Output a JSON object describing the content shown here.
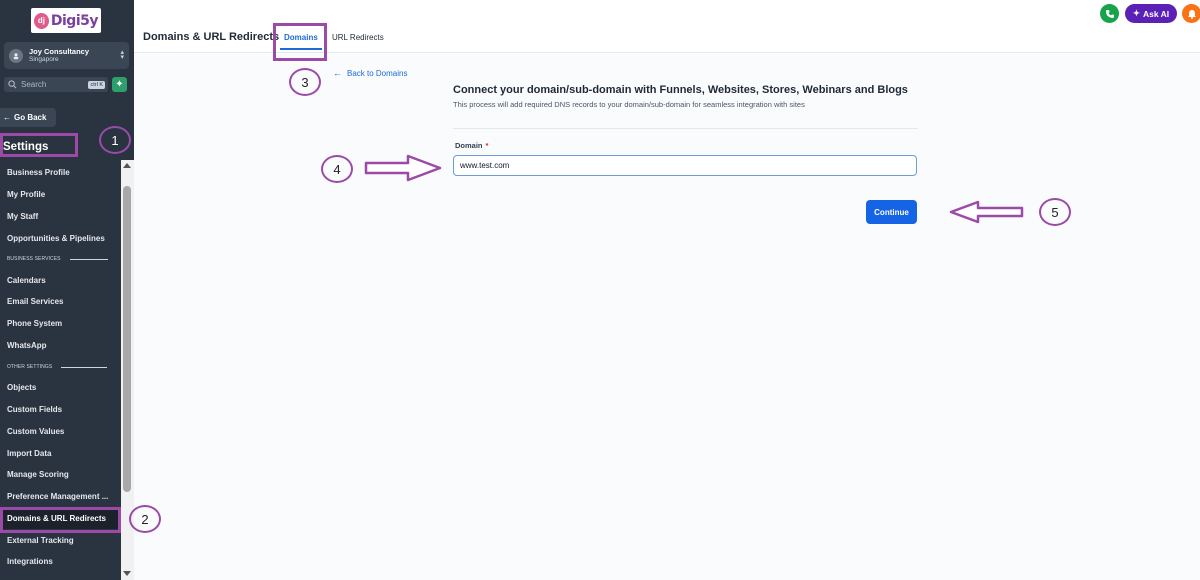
{
  "logo": {
    "text": "Digi5y",
    "mark": "dj",
    "tagline": "ALL IN ONE BUSINESS PLATFORM"
  },
  "account": {
    "name": "Joy Consultancy",
    "location": "Singapore"
  },
  "search": {
    "placeholder": "Search",
    "shortcut": "ctrl K"
  },
  "sidebar": {
    "go_back": "Go Back",
    "title": "Settings",
    "items": [
      {
        "label": "Business Profile"
      },
      {
        "label": "My Profile"
      },
      {
        "label": "My Staff"
      },
      {
        "label": "Opportunities & Pipelines"
      },
      {
        "section": "BUSINESS SERVICES"
      },
      {
        "label": "Calendars"
      },
      {
        "label": "Email Services"
      },
      {
        "label": "Phone System"
      },
      {
        "label": "WhatsApp"
      },
      {
        "section": "OTHER SETTINGS"
      },
      {
        "label": "Objects"
      },
      {
        "label": "Custom Fields"
      },
      {
        "label": "Custom Values"
      },
      {
        "label": "Import Data"
      },
      {
        "label": "Manage Scoring"
      },
      {
        "label": "Preference Management ..."
      },
      {
        "label": "Domains & URL Redirects",
        "active": true
      },
      {
        "label": "External Tracking"
      },
      {
        "label": "Integrations"
      }
    ]
  },
  "header": {
    "title": "Domains & URL Redirects",
    "tabs": [
      {
        "label": "Domains",
        "active": true
      },
      {
        "label": "URL Redirects",
        "active": false
      }
    ],
    "ask_ai": "Ask AI"
  },
  "main": {
    "back_link": "Back to Domains",
    "heading": "Connect your domain/sub-domain with Funnels, Websites, Stores, Webinars and Blogs",
    "subheading": "This process will add required DNS records to your domain/sub-domain for seamless integration with sites",
    "domain_label": "Domain",
    "required_mark": "*",
    "domain_value": "www.test.com",
    "continue_label": "Continue"
  },
  "annotations": [
    "1",
    "2",
    "3",
    "4",
    "5"
  ],
  "colors": {
    "sidebar_bg": "#2a3441",
    "accent": "#1564e6",
    "annotation": "#9b4aa8",
    "ask_ai_bg": "#5b21b6",
    "phone_bg": "#16a34a",
    "notification_bg": "#f97316"
  }
}
